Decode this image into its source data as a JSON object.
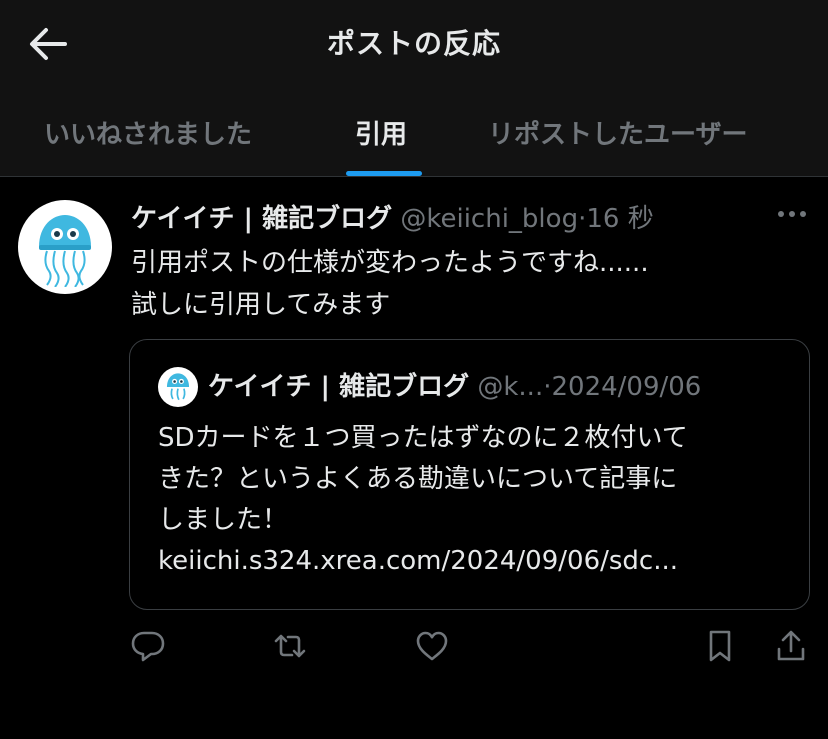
{
  "header": {
    "title": "ポストの反応"
  },
  "tabs": [
    {
      "label": "いいねされました"
    },
    {
      "label": "引用"
    },
    {
      "label": "リポストしたユーザー"
    }
  ],
  "post": {
    "author_name": "ケイイチ | 雑記ブログ",
    "handle": "@keiichi_blog",
    "separator": "·",
    "time": "16 秒",
    "text_lines": [
      "引用ポストの仕様が変わったようですね......",
      "試しに引用してみます"
    ],
    "quote": {
      "author_name": "ケイイチ | 雑記ブログ",
      "handle": "@k...",
      "separator": "·",
      "date": "2024/09/06",
      "text_lines": [
        "SDカードを１つ買ったはずなのに２枚付いて",
        "きた？というよくある勘違いについて記事に",
        "しました！",
        "keiichi.s324.xrea.com/2024/09/06/sdc..."
      ]
    }
  },
  "icons": {
    "back": "arrow-left-icon",
    "more": "more-horizontal-icon",
    "reply": "reply-icon",
    "repost": "repost-icon",
    "like": "heart-icon",
    "bookmark": "bookmark-icon",
    "share": "share-icon"
  },
  "colors": {
    "background": "#000000",
    "header_bg": "#121212",
    "accent": "#1d9bf0",
    "text": "#e7e9ea",
    "muted": "#71767b",
    "avatar_jellyfish": "#3fb8e0"
  }
}
